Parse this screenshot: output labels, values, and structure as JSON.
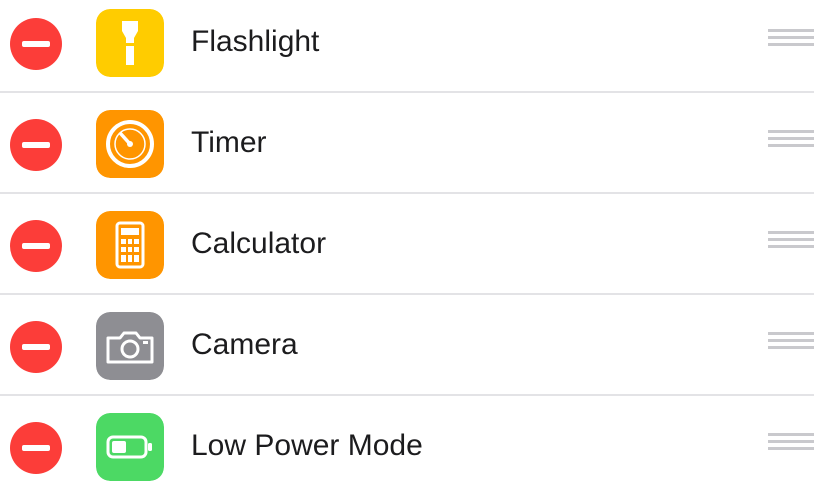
{
  "colors": {
    "remove": "#fc3d39",
    "flashlight": "#ffcc00",
    "timer": "#ff9500",
    "calculator": "#ff9500",
    "camera": "#8e8e93",
    "low_power": "#4cd964",
    "separator": "#e3e3e6",
    "handle": "#c9c9cd"
  },
  "items": [
    {
      "label": "Flashlight",
      "icon": "flashlight-icon"
    },
    {
      "label": "Timer",
      "icon": "timer-icon"
    },
    {
      "label": "Calculator",
      "icon": "calculator-icon"
    },
    {
      "label": "Camera",
      "icon": "camera-icon"
    },
    {
      "label": "Low Power Mode",
      "icon": "battery-icon"
    }
  ]
}
